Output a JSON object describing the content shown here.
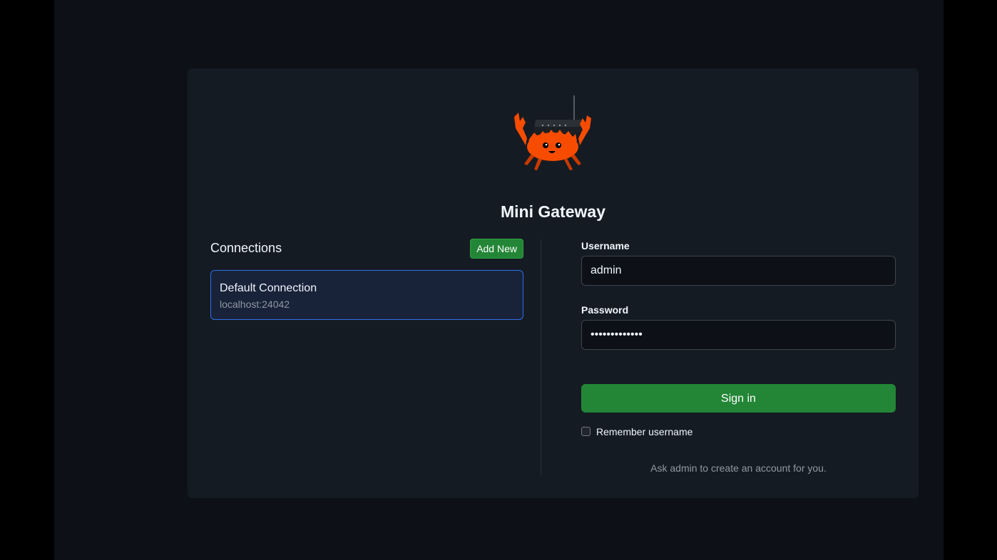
{
  "app": {
    "title": "Mini Gateway",
    "logo": "crab-with-router-logo"
  },
  "connections": {
    "heading": "Connections",
    "add_label": "Add New",
    "items": [
      {
        "name": "Default Connection",
        "address": "localhost:24042",
        "selected": true
      }
    ]
  },
  "login": {
    "username_label": "Username",
    "username_value": "admin",
    "password_label": "Password",
    "password_value": "*************",
    "submit_label": "Sign in",
    "remember_label": "Remember username",
    "remember_checked": false,
    "hint": "Ask admin to create an account for you."
  },
  "colors": {
    "accent_green": "#238636",
    "selection_blue": "#2f6feb",
    "logo_orange": "#f74c00"
  }
}
